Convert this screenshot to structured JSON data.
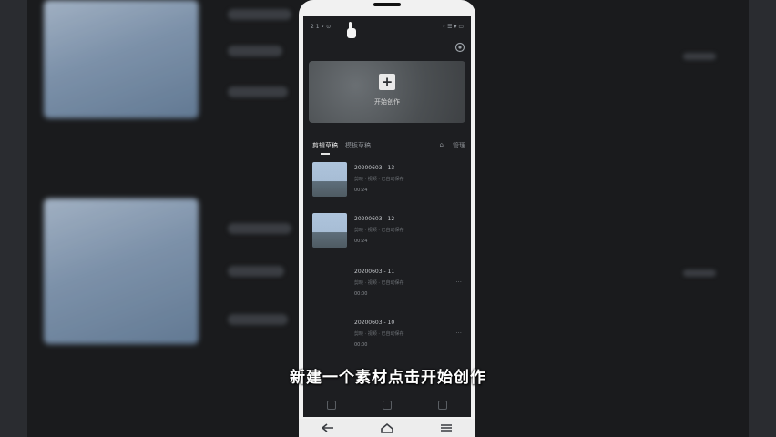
{
  "status_bar": {
    "left": "2 1 ⋆ ⊙",
    "right": "⋆ ☰ ▾ ▭"
  },
  "start_card": {
    "label": "开始创作"
  },
  "tabs": {
    "active_label": "剪辑草稿",
    "other_label": "模板草稿",
    "manage_label": "管理"
  },
  "drafts": [
    {
      "title": "20200603 - 13",
      "sub": "剪映 · 视频 · 已自动保存",
      "duration": "00:24",
      "has_thumb": true
    },
    {
      "title": "20200603 - 12",
      "sub": "剪映 · 视频 · 已自动保存",
      "duration": "00:24",
      "has_thumb": true
    },
    {
      "title": "20200603 - 11",
      "sub": "剪映 · 视频 · 已自动保存",
      "duration": "00:00",
      "has_thumb": false
    },
    {
      "title": "20200603 - 10",
      "sub": "剪映 · 视频 · 已自动保存",
      "duration": "00:00",
      "has_thumb": false
    }
  ],
  "subtitle": "新建一个素材点击开始创作",
  "icons": [
    "hand-pointer-icon",
    "settings-icon",
    "plus-icon",
    "back-icon",
    "home-icon",
    "recents-icon"
  ]
}
